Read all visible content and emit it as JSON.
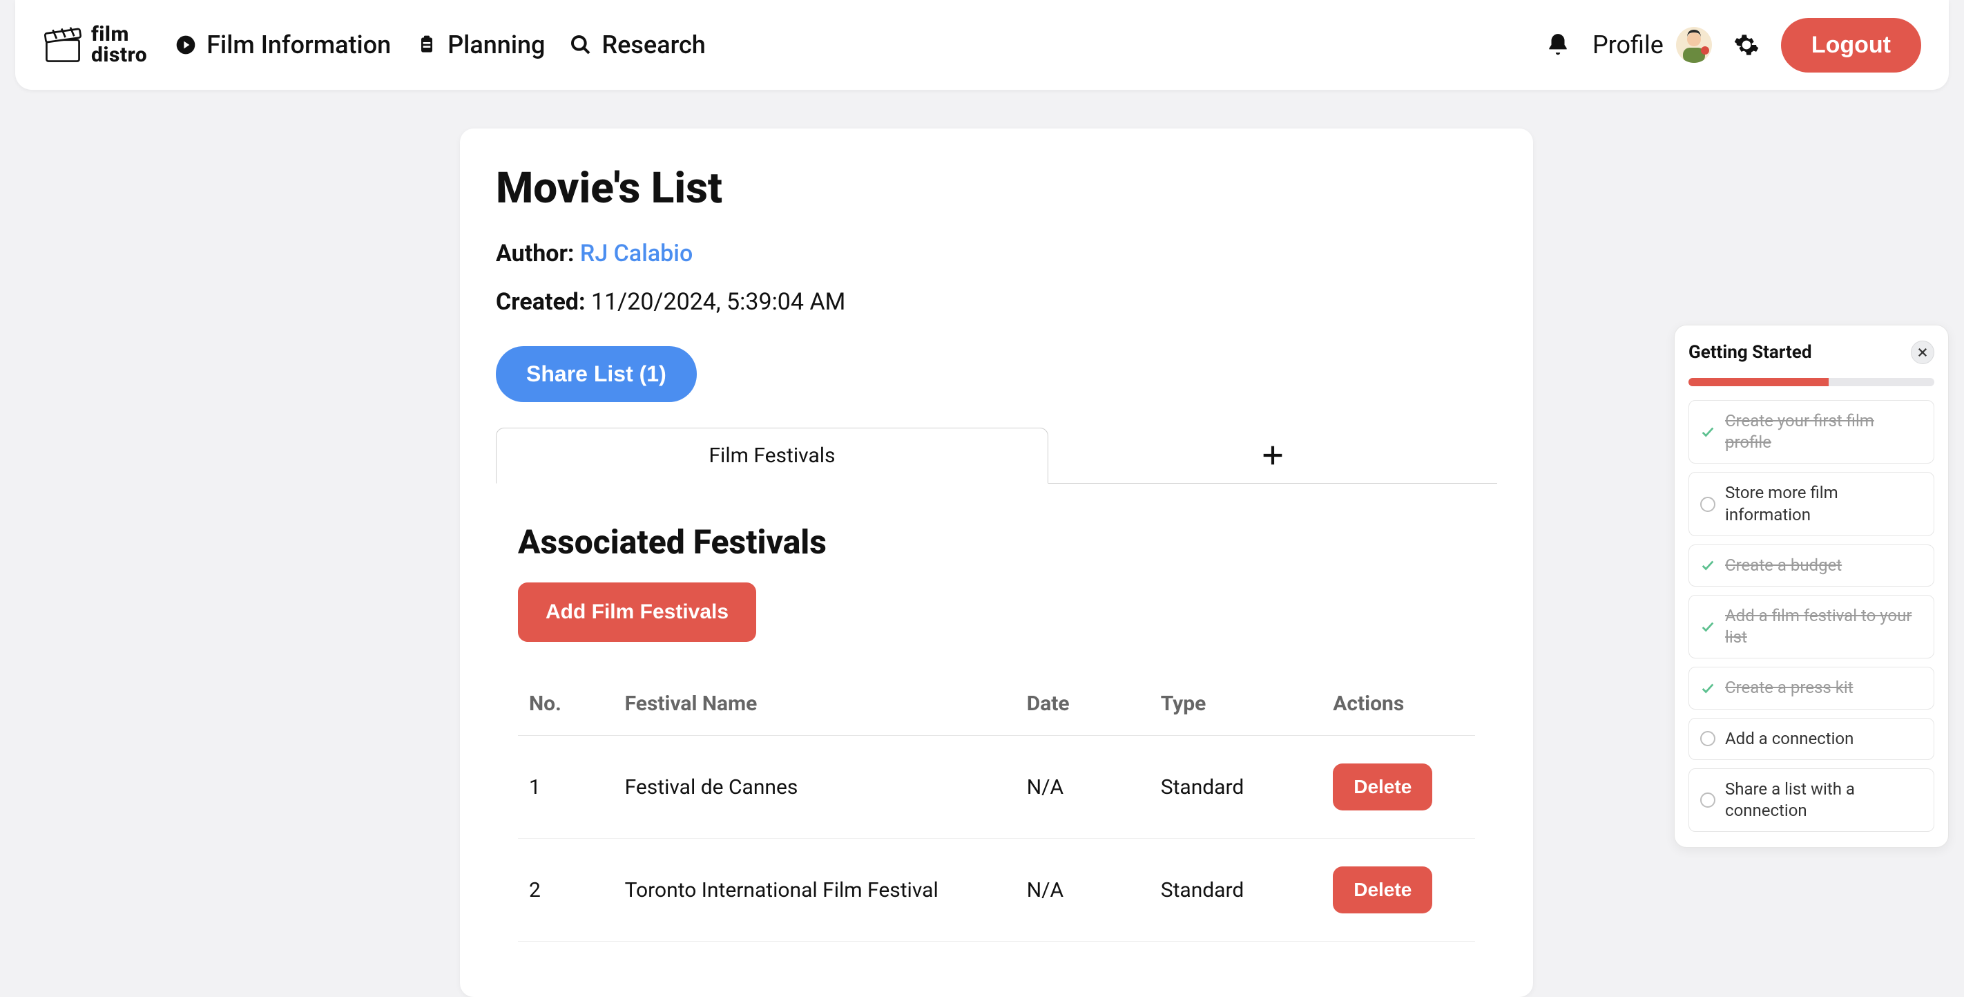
{
  "brand": {
    "line1": "film",
    "line2": "distro"
  },
  "nav": {
    "film_info": "Film Information",
    "planning": "Planning",
    "research": "Research"
  },
  "topbar": {
    "profile_label": "Profile",
    "logout_label": "Logout"
  },
  "page": {
    "title": "Movie's List",
    "author_label": "Author:",
    "author_name": "RJ Calabio",
    "created_label": "Created:",
    "created_value": "11/20/2024, 5:39:04 AM",
    "share_label": "Share List (1)"
  },
  "tabs": {
    "active": "Film Festivals"
  },
  "festivals": {
    "section_title": "Associated Festivals",
    "add_button": "Add Film Festivals",
    "columns": {
      "no": "No.",
      "name": "Festival Name",
      "date": "Date",
      "type": "Type",
      "actions": "Actions"
    },
    "delete_label": "Delete",
    "rows": [
      {
        "no": "1",
        "name": "Festival de Cannes",
        "date": "N/A",
        "type": "Standard"
      },
      {
        "no": "2",
        "name": "Toronto International Film Festival",
        "date": "N/A",
        "type": "Standard"
      }
    ]
  },
  "getting_started": {
    "title": "Getting Started",
    "progress_percent": 57,
    "items": [
      {
        "label": "Create your first film profile",
        "done": true
      },
      {
        "label": "Store more film information",
        "done": false
      },
      {
        "label": "Create a budget",
        "done": true
      },
      {
        "label": "Add a film festival to your list",
        "done": true
      },
      {
        "label": "Create a press kit",
        "done": true
      },
      {
        "label": "Add a connection",
        "done": false
      },
      {
        "label": "Share a list with a connection",
        "done": false
      }
    ]
  }
}
